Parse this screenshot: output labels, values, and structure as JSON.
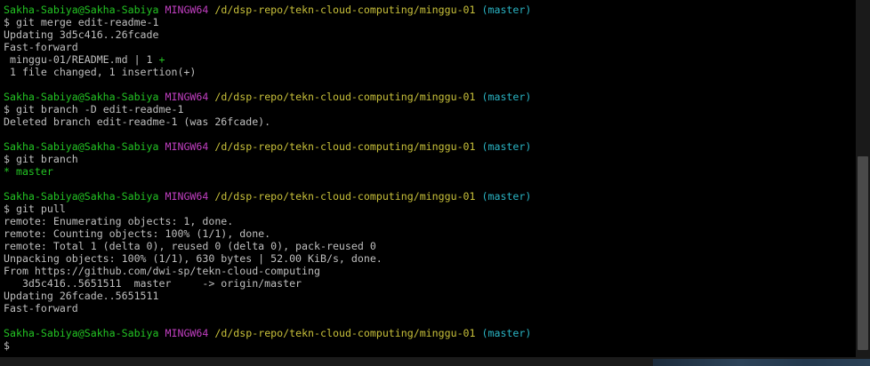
{
  "prompt": {
    "user_host": "Sakha-Sabiya@Sakha-Sabiya",
    "shell": "MINGW64",
    "path": "/d/dsp-repo/tekn-cloud-computing/minggu-01",
    "branch": "(master)",
    "symbol": "$"
  },
  "commands": {
    "merge": "git merge edit-readme-1",
    "branch_delete": "git branch -D edit-readme-1",
    "branch_list": "git branch",
    "pull": "git pull"
  },
  "merge_output": {
    "updating": "Updating 3d5c416..26fcade",
    "fast_forward": "Fast-forward",
    "file_stat": " minggu-01/README.md | 1 ",
    "file_stat_plus": "+",
    "summary": " 1 file changed, 1 insertion(+)"
  },
  "branch_delete_output": {
    "deleted": "Deleted branch edit-readme-1 (was 26fcade)."
  },
  "branch_list_output": {
    "current": "* master"
  },
  "pull_output": {
    "enumerating": "remote: Enumerating objects: 1, done.",
    "counting": "remote: Counting objects: 100% (1/1), done.",
    "total": "remote: Total 1 (delta 0), reused 0 (delta 0), pack-reused 0",
    "unpacking": "Unpacking objects: 100% (1/1), 630 bytes | 52.00 KiB/s, done.",
    "from": "From https://github.com/dwi-sp/tekn-cloud-computing",
    "ref_update": "   3d5c416..5651511  master     -> origin/master",
    "updating": "Updating 26fcade..5651511",
    "fast_forward": "Fast-forward"
  },
  "colors": {
    "background": "#000000",
    "text": "#bfbfbf",
    "user_host": "#23c423",
    "shell": "#c13fc1",
    "path": "#c8c03a",
    "branch": "#2ab4c4"
  }
}
